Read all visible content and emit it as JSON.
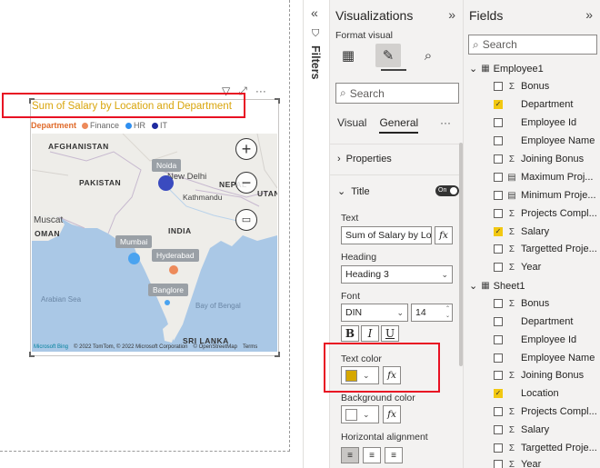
{
  "visual": {
    "title": "Sum of Salary by Location and Department",
    "title_color": "#d9a50c",
    "legend": {
      "title": "Department",
      "items": [
        {
          "label": "Finance",
          "color": "#ed8a5a"
        },
        {
          "label": "HR",
          "color": "#2f8ff0"
        },
        {
          "label": "IT",
          "color": "#1f2aa0"
        }
      ]
    },
    "map": {
      "labels": {
        "afghanistan": "AFGHANISTAN",
        "pakistan": "PAKISTAN",
        "nepal": "NEPAL",
        "kathmandu": "Kathmandu",
        "new_delhi": "New Delhi",
        "bhutan": "UTAN",
        "muscat": "Muscat",
        "oman": "OMAN",
        "india": "INDIA",
        "arabian_sea": "Arabian Sea",
        "bay_of_bengal": "Bay of Bengal",
        "sri_lanka": "SRI LANKA"
      },
      "cities": [
        {
          "name": "Noida",
          "color": "#3a4bbf",
          "bubble": "IT"
        },
        {
          "name": "Mumbai",
          "color": "#4aa3f0",
          "bubble": "HR"
        },
        {
          "name": "Hyderabad",
          "color": "#ed8a5a",
          "bubble": "Finance"
        },
        {
          "name": "Banglore",
          "color": "#4aa3f0",
          "bubble": "HR"
        }
      ],
      "footer": {
        "brand": "Microsoft Bing",
        "copyright": "© 2022 TomTom, © 2022 Microsoft Corporation",
        "osm": "© OpenStreetMap",
        "terms": "Terms"
      }
    }
  },
  "filters": {
    "label": "Filters"
  },
  "visualizations": {
    "title": "Visualizations",
    "format_visual_label": "Format visual",
    "search_placeholder": "Search",
    "tabs": [
      {
        "label": "Visual",
        "active": false
      },
      {
        "label": "General",
        "active": true
      }
    ],
    "more": "···",
    "sections": {
      "properties": "Properties",
      "title": "Title",
      "title_toggle": "On"
    },
    "title_settings": {
      "text_label": "Text",
      "text_value": "Sum of Salary by Location and Department",
      "heading_label": "Heading",
      "heading_value": "Heading 3",
      "font_label": "Font",
      "font_value": "DIN",
      "font_size": "14",
      "bold": "B",
      "italic": "I",
      "underline": "U",
      "text_color_label": "Text color",
      "text_color": "#d6a800",
      "background_color_label": "Background color",
      "background_color": "#ffffff",
      "horizontal_alignment_label": "Horizontal alignment",
      "fx": "fx"
    }
  },
  "fields": {
    "title": "Fields",
    "search_placeholder": "Search",
    "tables": [
      {
        "name": "Employee1",
        "fields": [
          {
            "name": "Bonus",
            "sigma": true,
            "checked": false
          },
          {
            "name": "Department",
            "sigma": false,
            "checked": true
          },
          {
            "name": "Employee Id",
            "sigma": false,
            "checked": false
          },
          {
            "name": "Employee Name",
            "sigma": false,
            "checked": false
          },
          {
            "name": "Joining Bonus",
            "sigma": true,
            "checked": false
          },
          {
            "name": "Maximum Proj...",
            "sigma": false,
            "calc": true,
            "checked": false
          },
          {
            "name": "Minimum Proje...",
            "sigma": false,
            "calc": true,
            "checked": false
          },
          {
            "name": "Projects Compl...",
            "sigma": true,
            "checked": false
          },
          {
            "name": "Salary",
            "sigma": true,
            "checked": true
          },
          {
            "name": "Targetted Proje...",
            "sigma": true,
            "checked": false
          },
          {
            "name": "Year",
            "sigma": true,
            "checked": false
          }
        ]
      },
      {
        "name": "Sheet1",
        "fields": [
          {
            "name": "Bonus",
            "sigma": true,
            "checked": false
          },
          {
            "name": "Department",
            "sigma": false,
            "checked": false
          },
          {
            "name": "Employee Id",
            "sigma": false,
            "checked": false
          },
          {
            "name": "Employee Name",
            "sigma": false,
            "checked": false
          },
          {
            "name": "Joining Bonus",
            "sigma": true,
            "checked": false
          },
          {
            "name": "Location",
            "sigma": false,
            "checked": true
          },
          {
            "name": "Projects Compl...",
            "sigma": true,
            "checked": false
          },
          {
            "name": "Salary",
            "sigma": true,
            "checked": false
          },
          {
            "name": "Targetted Proje...",
            "sigma": true,
            "checked": false
          },
          {
            "name": "Year",
            "sigma": true,
            "checked": false
          }
        ]
      }
    ]
  }
}
